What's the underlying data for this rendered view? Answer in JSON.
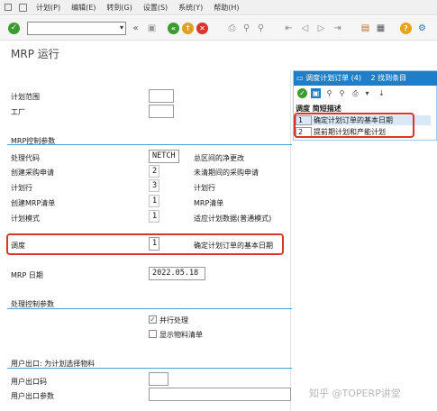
{
  "menu": {
    "items": [
      "计划(P)",
      "编辑(E)",
      "转到(G)",
      "设置(S)",
      "系统(Y)",
      "帮助(H)"
    ]
  },
  "toolbar": {
    "command_placeholder": "",
    "icons": [
      "check-icon",
      "back-icon",
      "exit-icon",
      "cancel-icon",
      "print-icon",
      "find-icon",
      "help-icon",
      "gear-icon"
    ]
  },
  "title": "MRP 运行",
  "fields": {
    "plan_scope_label": "计划范围",
    "plant_label": "工厂",
    "plan_scope_value": "",
    "plant_value": ""
  },
  "mrp_control": {
    "group_title": "MRP控制参数",
    "rows": [
      {
        "label": "处理代码",
        "value": "NETCH",
        "desc": "总区间的净更改"
      },
      {
        "label": "创建采购申请",
        "value": "2",
        "desc": "未清期间的采购申请"
      },
      {
        "label": "计划行",
        "value": "3",
        "desc": "计划行"
      },
      {
        "label": "创建MRP清单",
        "value": "1",
        "desc": "MRP清单"
      },
      {
        "label": "计划模式",
        "value": "1",
        "desc": "适应计划数据(普通模式)"
      }
    ]
  },
  "scheduling": {
    "label": "调度",
    "value": "1",
    "desc": "确定计划订单的基本日期"
  },
  "mrp_date": {
    "label": "MRP 日期",
    "value": "2022.05.18"
  },
  "process_control": {
    "group_title": "处理控制参数",
    "parallel_label": "并行处理",
    "parallel_checked": true,
    "show_list_label": "显示物料清单",
    "show_list_checked": false
  },
  "user_exit": {
    "group_title": "用户出口: 为计划选择物料",
    "key_label": "用户出口码",
    "param_label": "用户出口参数",
    "key_value": "",
    "param_value": ""
  },
  "popup": {
    "title": "调度计划订单 (4)",
    "entries_found": "2 找到条目",
    "col_header": "调度 简短描述",
    "rows": [
      {
        "key": "1",
        "text": "确定计划订单的基本日期"
      },
      {
        "key": "2",
        "text": "提前期计划和产能计划"
      }
    ]
  },
  "watermark": "知乎 @TOPERP讲堂",
  "colors": {
    "accent_blue": "#1f7ec6",
    "group_line": "#4aa3d8",
    "highlight_red": "#d9362b",
    "ok_green": "#3a9b2f"
  }
}
